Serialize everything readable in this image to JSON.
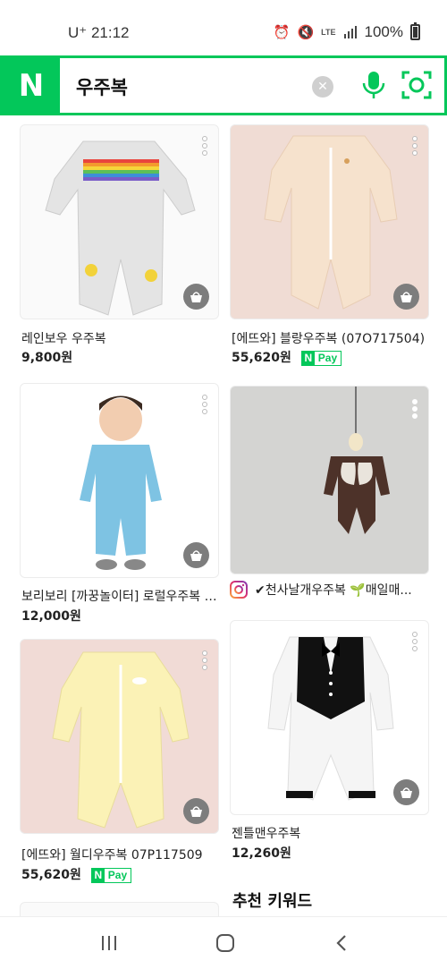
{
  "status_bar": {
    "carrier": "U⁺ 21:12",
    "network": "LTE",
    "battery": "100%"
  },
  "search": {
    "logo": "N",
    "query": "우주복",
    "clear_icon": "clear-icon",
    "voice_icon": "microphone-icon",
    "lens_icon": "camera-lens-icon"
  },
  "products": [
    {
      "title": "레인보우 우주복",
      "price": "9,800원",
      "npay": false
    },
    {
      "title": "[에뜨와] 블랑우주복 (07O717504)",
      "price": "55,620원",
      "npay": true
    },
    {
      "title": "보리보리 [까꿍놀이터] 로럴우주복 -...",
      "price": "12,000원",
      "npay": false
    },
    {
      "title": "✔천사날개우주복 🌱매일매...",
      "price": "",
      "npay": false,
      "instagram": true
    },
    {
      "title": "[에뜨와] 월디우주복 07P117509",
      "price": "55,620원",
      "npay": true
    },
    {
      "title": "젠틀맨우주복",
      "price": "12,260원",
      "npay": false
    }
  ],
  "npay_label": {
    "n": "N",
    "pay": "Pay"
  },
  "recommend_title": "추천 키워드",
  "colors": {
    "brand": "#03c75a",
    "cart": "#7d7d7d"
  }
}
